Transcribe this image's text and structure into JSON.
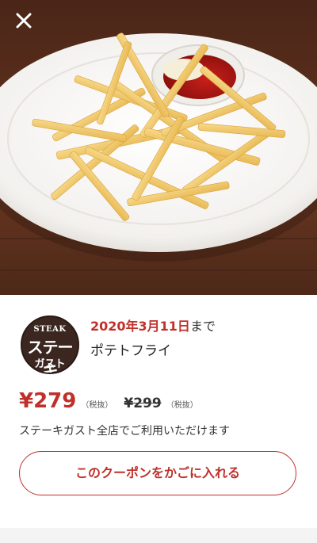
{
  "header": {
    "close_icon": "close-icon"
  },
  "hero": {
    "image": "french-fries-plate-with-ketchup"
  },
  "logo": {
    "line1": "STEAK",
    "line2": "ステーキ",
    "line3": "ガスト"
  },
  "coupon": {
    "valid_date": "2020年3月11日",
    "valid_suffix": "まで",
    "item_name": "ポテトフライ",
    "price_now": "¥279",
    "price_now_tax": "（税抜）",
    "price_was": "¥299",
    "price_was_tax": "（税抜）",
    "stores_note": "ステーキガスト全店でご利用いただけます",
    "cta_label": "このクーポンをかごに入れる"
  },
  "colors": {
    "accent": "#c0302b",
    "logo_bg": "#3b2620"
  }
}
